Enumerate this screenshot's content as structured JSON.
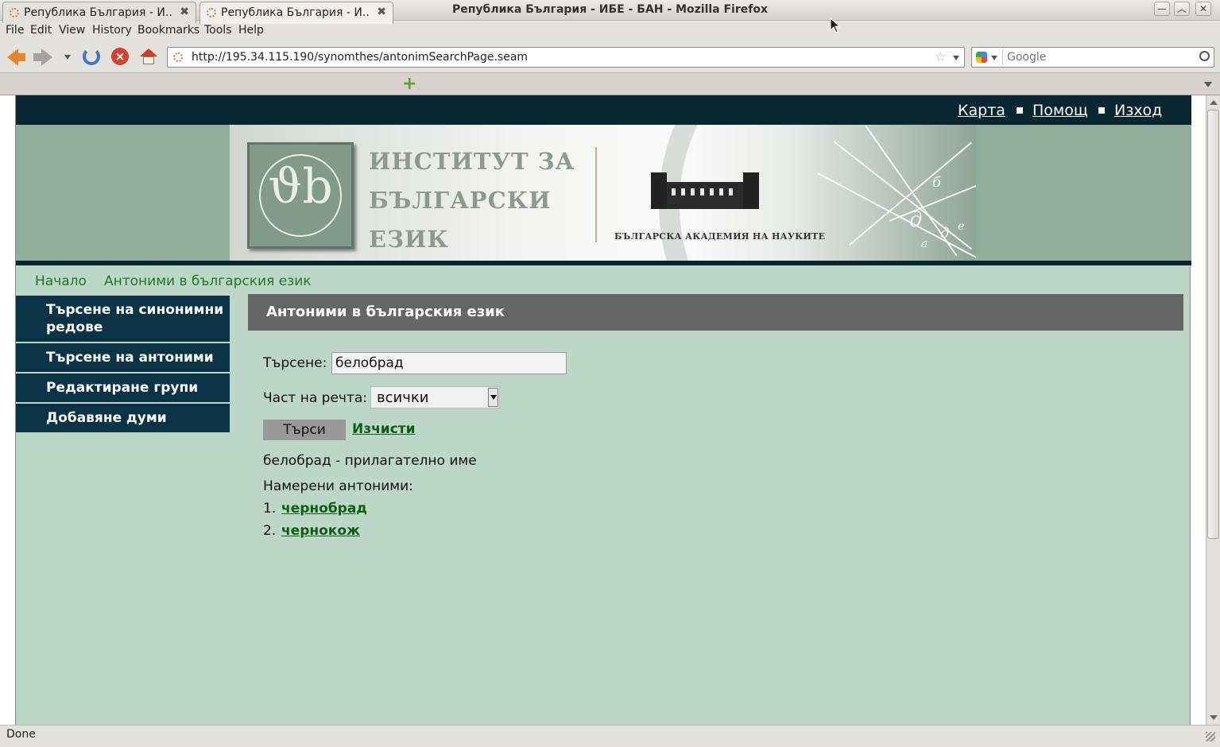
{
  "window": {
    "title": "Република България - ИБЕ - БАН - Mozilla Firefox",
    "controls": {
      "minimize": "—",
      "maximize": "︿",
      "close": "✕"
    }
  },
  "menu": [
    "File",
    "Edit",
    "View",
    "History",
    "Bookmarks",
    "Tools",
    "Help"
  ],
  "browser": {
    "url": "http://195.34.115.190/synomthes/antonimSearchPage.seam",
    "search_placeholder": "Google",
    "tabs": [
      {
        "label": "Република България - И...",
        "active": false
      },
      {
        "label": "Република България - И...",
        "active": true
      }
    ],
    "new_tab": "+",
    "status": "Done"
  },
  "site": {
    "top_links": [
      "Карта",
      "Помощ",
      "Изход"
    ],
    "banner": {
      "institute_lines": [
        "ИНСТИТУТ ЗА",
        "БЪЛГАРСКИ",
        "ЕЗИК"
      ],
      "academy": "БЪЛГАРСКА АКАДЕМИЯ НА НАУКИТЕ",
      "logo_monogram": "ϑb",
      "logo_ring_text": "ИНСТИТУТ ЗА БЪЛГАРСКИ ЕЗИК",
      "decor_letters": [
        "б",
        "д",
        "д",
        "е",
        "а"
      ]
    },
    "breadcrumb": [
      "Начало",
      "Антоними в българския език"
    ],
    "sidebar": [
      "Търсене на синонимни редове",
      "Търсене на антоними",
      "Редактиране групи",
      "Добавяне думи"
    ]
  },
  "main": {
    "header": "Антоними в българския език",
    "search_label": "Търсене:",
    "search_value": "белобрад",
    "pos_label": "Част на речта:",
    "pos_value": "всички",
    "search_button": "Търси",
    "clear_link": "Изчисти",
    "result_word": "белобрад - прилагателно име",
    "found_label": "Намерени антоними:",
    "results": [
      {
        "num": "1.",
        "word": "чернобрад"
      },
      {
        "num": "2.",
        "word": "чернокож"
      }
    ]
  },
  "colors": {
    "page_bg": "#bcd6c8",
    "dark_navy": "#082630",
    "sidebar_bg": "#0a3346",
    "header_gray": "#666666",
    "link_green": "#0e5f12",
    "breadcrumb_green": "#1e7a22"
  }
}
